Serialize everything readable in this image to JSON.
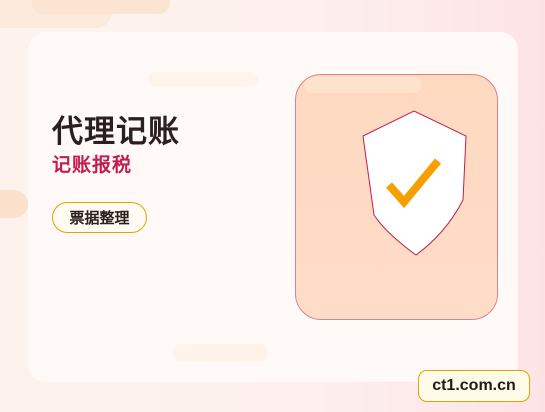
{
  "card": {
    "title": "代理记账",
    "subtitle": "记账报税",
    "chip_label": "票据整理"
  },
  "illustration": {
    "icon": "shield-check-icon",
    "shield_fill": "#ffffff",
    "shield_outline": "#c41c4c",
    "check_color": "#f5a000",
    "panel_color": "#fdd9c0",
    "panel_border": "#d9838f"
  },
  "watermark": {
    "text": "ct1.com.cn"
  },
  "colors": {
    "accent_red": "#c41c4c",
    "accent_orange": "#e5a100",
    "title_color": "#2b1f1f"
  }
}
